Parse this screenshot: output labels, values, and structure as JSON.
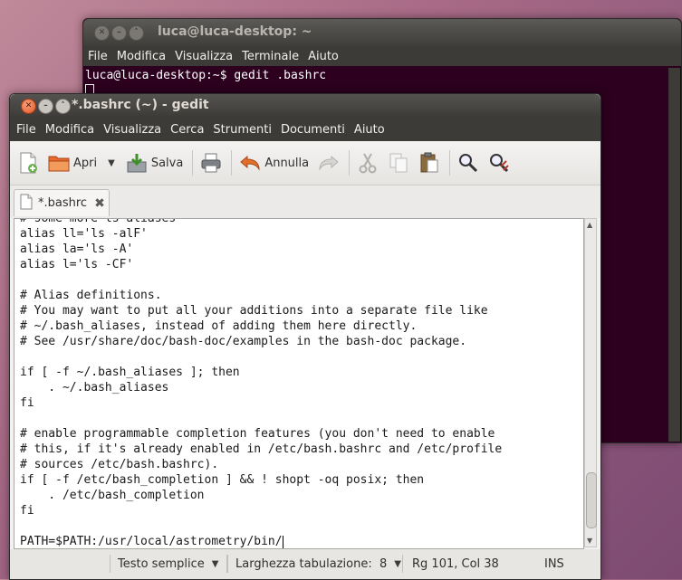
{
  "terminal": {
    "title": "luca@luca-desktop: ~",
    "menu": [
      "File",
      "Modifica",
      "Visualizza",
      "Terminale",
      "Aiuto"
    ],
    "prompt_line": "luca@luca-desktop:~$ gedit .bashrc"
  },
  "gedit": {
    "title": "*.bashrc (~) - gedit",
    "menu": [
      "File",
      "Modifica",
      "Visualizza",
      "Cerca",
      "Strumenti",
      "Documenti",
      "Aiuto"
    ],
    "toolbar": {
      "open_label": "Apri",
      "save_label": "Salva",
      "undo_label": "Annulla"
    },
    "tab": {
      "label": "*.bashrc"
    },
    "code_lines": [
      "# some more ls aliases",
      "alias ll='ls -alF'",
      "alias la='ls -A'",
      "alias l='ls -CF'",
      "",
      "# Alias definitions.",
      "# You may want to put all your additions into a separate file like",
      "# ~/.bash_aliases, instead of adding them here directly.",
      "# See /usr/share/doc/bash-doc/examples in the bash-doc package.",
      "",
      "if [ -f ~/.bash_aliases ]; then",
      "    . ~/.bash_aliases",
      "fi",
      "",
      "# enable programmable completion features (you don't need to enable",
      "# this, if it's already enabled in /etc/bash.bashrc and /etc/profile",
      "# sources /etc/bash.bashrc).",
      "if [ -f /etc/bash_completion ] && ! shopt -oq posix; then",
      "    . /etc/bash_completion",
      "fi",
      "",
      "PATH=$PATH:/usr/local/astrometry/bin/"
    ],
    "statusbar": {
      "language": "Testo semplice",
      "tab_width": "Larghezza tabulazione:  8",
      "position": "Rg 101, Col 38",
      "mode": "INS"
    }
  }
}
